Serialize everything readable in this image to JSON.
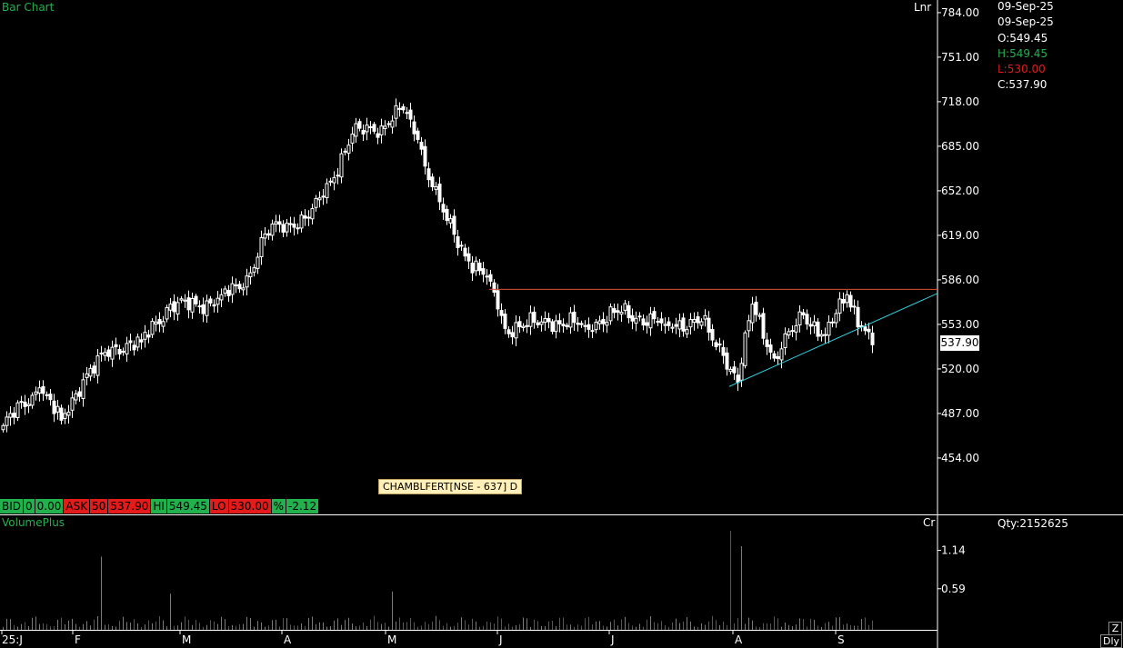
{
  "title": "Bar Chart",
  "scale_label": "Lnr",
  "volume_title": "VolumePlus",
  "volume_unit": "Cr",
  "symbol_tooltip": "CHAMBLFERT[NSE - 637] D",
  "info_panel": {
    "date1": "09-Sep-25",
    "date2": "09-Sep-25",
    "open": "O:549.45",
    "high": "H:549.45",
    "low": "L:530.00",
    "close": "C:537.90",
    "qty": "Qty:2152625"
  },
  "quote_bar": {
    "bid_label": "BID",
    "bid_qty": "0",
    "bid_price": "0.00",
    "ask_label": "ASK",
    "ask_qty": "50",
    "ask_price": "537.90",
    "hi_label": "HI",
    "hi_value": "549.45",
    "lo_label": "LO",
    "lo_value": "530.00",
    "pct_label": "%",
    "pct_value": "-2.12"
  },
  "last_price": "537.90",
  "corner": {
    "zoom": "Z",
    "period": "Dly"
  },
  "colors": {
    "up": "#22b14c",
    "down": "#e31b1b",
    "resistance": "#e05030",
    "support": "#30d0e0",
    "grid": "#ffffff"
  },
  "chart_data": {
    "type": "candlestick",
    "y_axis": {
      "ticks": [
        "784.00",
        "751.00",
        "718.00",
        "685.00",
        "652.00",
        "619.00",
        "586.00",
        "553.00",
        "520.00",
        "487.00",
        "454.00"
      ],
      "ylim": [
        425,
        790
      ],
      "scale": "linear"
    },
    "x_axis": {
      "ticks": [
        "25:J",
        "F",
        "M",
        "A",
        "M",
        "J",
        "J",
        "A",
        "S"
      ]
    },
    "anchor_closes": [
      {
        "i": 0,
        "c": 478
      },
      {
        "i": 10,
        "c": 506
      },
      {
        "i": 16,
        "c": 482
      },
      {
        "i": 22,
        "c": 512
      },
      {
        "i": 30,
        "c": 536
      },
      {
        "i": 38,
        "c": 540
      },
      {
        "i": 46,
        "c": 568
      },
      {
        "i": 54,
        "c": 566
      },
      {
        "i": 60,
        "c": 575
      },
      {
        "i": 66,
        "c": 580
      },
      {
        "i": 72,
        "c": 620
      },
      {
        "i": 78,
        "c": 628
      },
      {
        "i": 84,
        "c": 632
      },
      {
        "i": 88,
        "c": 648
      },
      {
        "i": 96,
        "c": 694
      },
      {
        "i": 104,
        "c": 700
      },
      {
        "i": 110,
        "c": 712
      },
      {
        "i": 114,
        "c": 690
      },
      {
        "i": 118,
        "c": 655
      },
      {
        "i": 122,
        "c": 630
      },
      {
        "i": 128,
        "c": 600
      },
      {
        "i": 134,
        "c": 585
      },
      {
        "i": 138,
        "c": 550
      },
      {
        "i": 150,
        "c": 555
      },
      {
        "i": 160,
        "c": 552
      },
      {
        "i": 170,
        "c": 562
      },
      {
        "i": 182,
        "c": 553
      },
      {
        "i": 192,
        "c": 555
      },
      {
        "i": 198,
        "c": 530
      },
      {
        "i": 202,
        "c": 510
      },
      {
        "i": 206,
        "c": 568
      },
      {
        "i": 212,
        "c": 528
      },
      {
        "i": 220,
        "c": 560
      },
      {
        "i": 226,
        "c": 545
      },
      {
        "i": 232,
        "c": 575
      },
      {
        "i": 236,
        "c": 552
      },
      {
        "i": 239,
        "c": 537.9
      }
    ],
    "bar_count": 240,
    "volume": {
      "ticks": [
        "1.14",
        "0.59"
      ],
      "ylim": [
        0,
        1.5
      ],
      "peaks": [
        {
          "i": 27,
          "v": 1.05
        },
        {
          "i": 200,
          "v": 1.42
        },
        {
          "i": 203,
          "v": 1.2
        },
        {
          "i": 107,
          "v": 0.55
        },
        {
          "i": 46,
          "v": 0.52
        }
      ]
    },
    "resistance_line": {
      "price": 579,
      "from_index": 134,
      "to_index": 260
    },
    "support_line": {
      "from": {
        "i": 200,
        "p": 507
      },
      "to": {
        "i": 258,
        "p": 576
      }
    }
  }
}
